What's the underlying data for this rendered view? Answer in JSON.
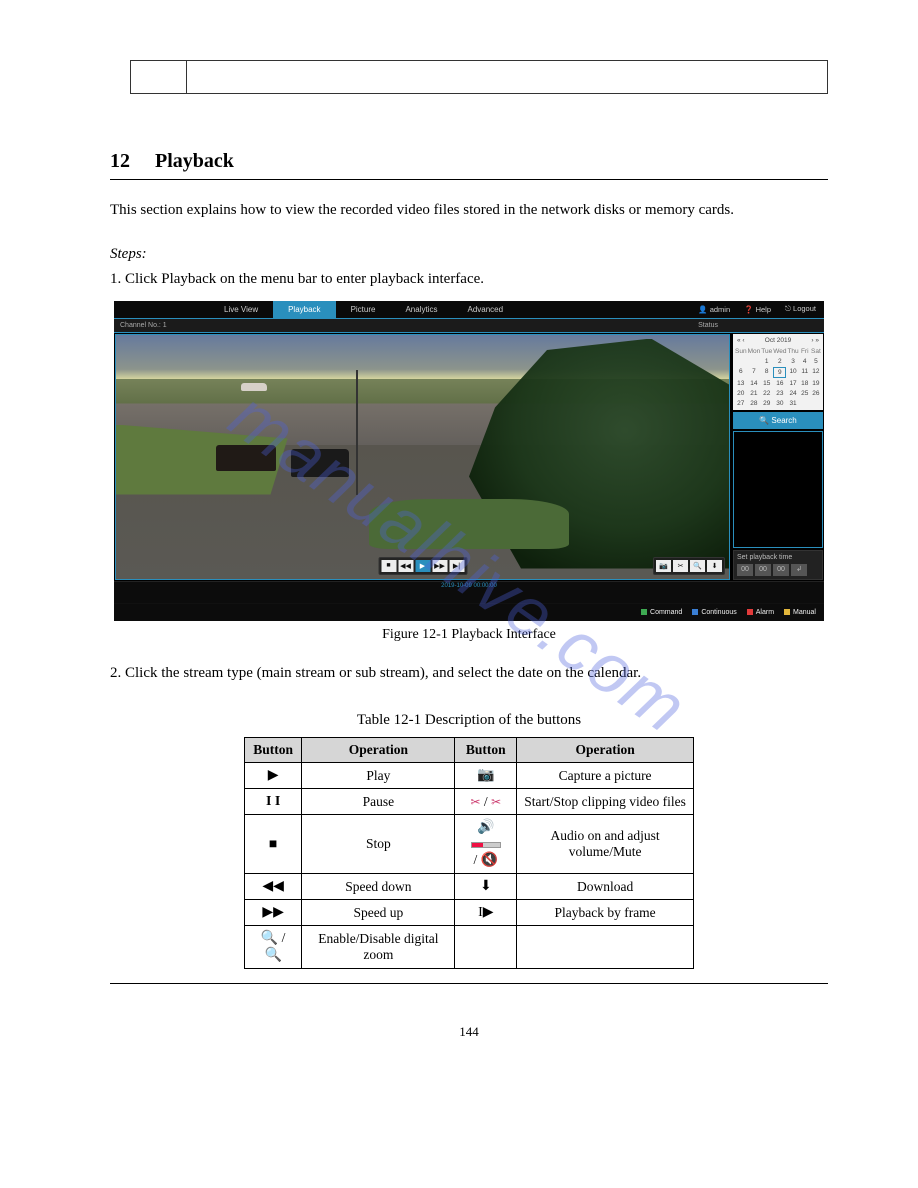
{
  "section": {
    "number": "12",
    "title": "Playback"
  },
  "intro_text": "This section explains how to view the recorded video files stored in the network disks or memory cards.",
  "steps_title": "Steps:",
  "step1": "Click Playback on the menu bar to enter playback interface.",
  "figure_label": "Figure 12-1 Playback Interface",
  "step2": "Click the stream type (main stream or sub stream), and select the date on the calendar.",
  "table_label": "Table 12-1 Description of the buttons",
  "ui": {
    "tabs": [
      "Live View",
      "Playback",
      "Picture",
      "Analytics",
      "Advanced"
    ],
    "active_tab": "Playback",
    "user": "admin",
    "help": "Help",
    "logout": "Logout",
    "channel": "Channel No.: 1",
    "status": "Status",
    "calendar": {
      "month": "Oct",
      "year": "2019",
      "dow": [
        "Sun",
        "Mon",
        "Tue",
        "Wed",
        "Thu",
        "Fri",
        "Sat"
      ],
      "rows": [
        [
          "",
          "",
          "1",
          "2",
          "3",
          "4",
          "5"
        ],
        [
          "6",
          "7",
          "8",
          "9",
          "10",
          "11",
          "12"
        ],
        [
          "13",
          "14",
          "15",
          "16",
          "17",
          "18",
          "19"
        ],
        [
          "20",
          "21",
          "22",
          "23",
          "24",
          "25",
          "26"
        ],
        [
          "27",
          "28",
          "29",
          "30",
          "31",
          "",
          ""
        ]
      ],
      "selected": "9"
    },
    "search": "Search",
    "set_time_label": "Set playback time",
    "set_time": [
      "00",
      "00",
      "00"
    ],
    "timeline_label": "2019-10-09 00:00:00",
    "legend": [
      {
        "label": "Command",
        "color": "#3eaa52"
      },
      {
        "label": "Continuous",
        "color": "#3a7ed4"
      },
      {
        "label": "Alarm",
        "color": "#e23b3b"
      },
      {
        "label": "Manual",
        "color": "#e2b63b"
      }
    ]
  },
  "table": {
    "headers": [
      "Button",
      "Operation",
      "Button",
      "Operation"
    ],
    "rows": [
      {
        "op1": "Play",
        "op2": "Capture a picture",
        "b1": "play",
        "b2": "camera"
      },
      {
        "op1": "Pause",
        "op2": "Start/Stop clipping video files",
        "b1": "pause",
        "b2": "clip"
      },
      {
        "op1": "Stop",
        "op2": "Audio on and adjust volume/Mute",
        "b1": "stop",
        "b2": "audio"
      },
      {
        "op1": "Speed down",
        "op2": "Download",
        "b1": "rewind",
        "b2": "download"
      },
      {
        "op1": "Speed up",
        "op2": "Playback by frame",
        "b1": "forward",
        "b2": "frame"
      },
      {
        "op1": "Enable/Disable digital zoom",
        "op2": "",
        "b1": "zoom",
        "b2": ""
      }
    ]
  },
  "watermark": "manualhive.com",
  "page_number": "144"
}
